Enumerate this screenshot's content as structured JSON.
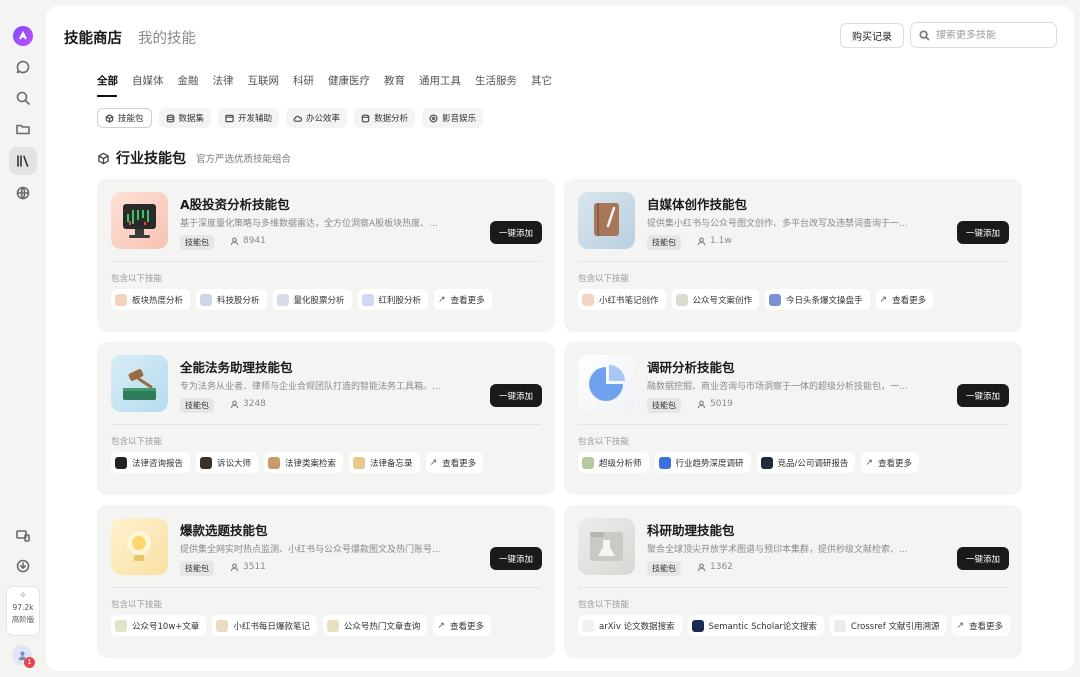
{
  "header": {
    "title": "技能商店",
    "title2": "我的技能",
    "records_label": "购买记录",
    "search_placeholder": "搜索更多技能"
  },
  "sidebar": {
    "points_value": "97.2k",
    "points_tier": "高阶版",
    "notification_count": "1",
    "icons": [
      "chat-icon",
      "search-icon",
      "folder-icon",
      "library-icon",
      "globe-icon",
      "devices-icon",
      "download-icon"
    ]
  },
  "tabs": [
    "全部",
    "自媒体",
    "金融",
    "法律",
    "互联网",
    "科研",
    "健康医疗",
    "教育",
    "通用工具",
    "生活服务",
    "其它"
  ],
  "chips": [
    "技能包",
    "数据集",
    "开发辅助",
    "办公效率",
    "数据分析",
    "影音娱乐"
  ],
  "section": {
    "title": "行业技能包",
    "subtitle": "官方严选优质技能组合"
  },
  "labels": {
    "tag": "技能包",
    "add": "一键添加",
    "includes": "包含以下技能"
  },
  "cards": [
    {
      "name": "A股投资分析技能包",
      "desc": "基于深度量化策略与多维数据雷达，全方位洞察A股板块热度、...",
      "users": "8941",
      "skills": [
        "板块热度分析",
        "科技股分析",
        "量化股票分析",
        "红利股分析",
        "查看更多"
      ]
    },
    {
      "name": "自媒体创作技能包",
      "desc": "提供集小红书与公众号图文创作、多平台改写及违禁词查询于一...",
      "users": "1.1w",
      "skills": [
        "小红书笔记创作",
        "公众号文案创作",
        "今日头条爆文操盘手",
        "查看更多"
      ]
    },
    {
      "name": "全能法务助理技能包",
      "desc": "专为法务从业者、律师与企业合规团队打造的智能法务工具箱。...",
      "users": "3248",
      "skills": [
        "法律咨询报告",
        "诉讼大师",
        "法律类案检索",
        "法律备忘录",
        "查看更多"
      ]
    },
    {
      "name": "调研分析技能包",
      "desc": "融数据挖掘、商业咨询与市场洞察于一体的超级分析技能包，一...",
      "users": "5019",
      "skills": [
        "超级分析师",
        "行业趋势深度调研",
        "竞品/公司调研报告",
        "查看更多"
      ]
    },
    {
      "name": "爆款选题技能包",
      "desc": "提供集全网实时热点监测、小红书与公众号爆款图文及热门账号...",
      "users": "3511",
      "skills": [
        "公众号10w+文章",
        "小红书每日爆款笔记",
        "公众号热门文章查询",
        "查看更多"
      ]
    },
    {
      "name": "科研助理技能包",
      "desc": "聚合全球顶尖开放学术图谱与预印本集群，提供秒级文献检索、...",
      "users": "1362",
      "skills": [
        "arXiv 论文数据搜索",
        "Semantic Scholar论文搜索",
        "Crossref 文献引用溯源",
        "查看更多"
      ]
    }
  ]
}
